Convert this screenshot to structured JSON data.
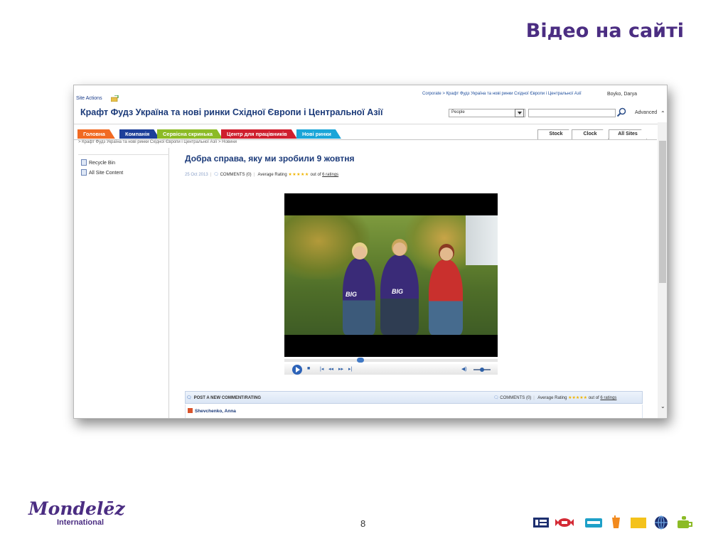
{
  "slide": {
    "title": "Відео на сайті",
    "page_number": "8",
    "logo": {
      "main": "Mondelēz",
      "sub": "International"
    }
  },
  "topbar": {
    "site_actions": "Site Actions",
    "breadcrumb": "Corporate > Крафт Фудз Україна та нові ринки Східної Європи і Центральної Азії",
    "user": "Boyko, Darya"
  },
  "header": {
    "site_title": "Крафт Фудз Україна та нові ринки Східної Європи і Центральної Азії",
    "search_scope": "People",
    "search_value": "",
    "advanced_label": "Advanced"
  },
  "nav_tabs": [
    {
      "label": "Головна",
      "color": "#f16a22"
    },
    {
      "label": "Компанія",
      "color": "#1d3f9a"
    },
    {
      "label": "Сервісна скринька",
      "color": "#8cbb26"
    },
    {
      "label": "Центр для працівників",
      "color": "#cf1f2e"
    },
    {
      "label": "Нові ринки",
      "color": "#1ba5d8"
    }
  ],
  "right_tabs": [
    "Stock",
    "Clock",
    "All Sites"
  ],
  "breadcrumb2": "> Крафт Фудз Україна та нові ринки Східної Європи і Центральної Азії > Новини",
  "left_nav": [
    "Recycle Bin",
    "All Site Content"
  ],
  "article": {
    "title": "Добра справа, яку ми зробили 9 жовтня",
    "date": "25 Oct 2013",
    "comments": "COMMENTS (0)",
    "rating_label": "Average Rating",
    "rating_suffix": "out of",
    "ratings_link": "6 ratings",
    "shirt_text": "BIG"
  },
  "video_player": {
    "progress": 0.35,
    "volume": 0.5
  },
  "comments_section": {
    "post_label": "POST A NEW COMMENT/RATING",
    "comments": "COMMENTS (0)",
    "rating_label": "Average Rating",
    "rating_suffix": "out of",
    "ratings_link": "6 ratings",
    "first_author": "Shevchenko, Anna"
  },
  "icons": {
    "search": "search-icon",
    "play": "play-icon",
    "stop": "stop-icon",
    "volume": "volume-icon",
    "comment": "comment-bubble-icon",
    "star": "star-icon"
  }
}
